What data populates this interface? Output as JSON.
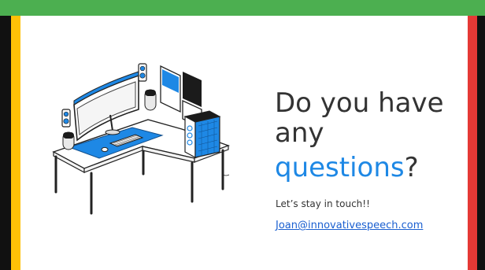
{
  "slide": {
    "heading_line1": "Do you have",
    "heading_line2": "any",
    "heading_line3_accent": "questions",
    "heading_line3_suffix": "?",
    "tagline": "Let’s stay in touch!!",
    "email": "Joan@innovativespeech.com"
  },
  "illustration": {
    "subject": "desk-setup-illustration",
    "accent_color": "#1e88e5",
    "items": [
      "curved-monitor-icon",
      "speaker-icon",
      "keyboard-icon",
      "mouse-icon",
      "pc-tower-icon",
      "picture-frame-icon",
      "desk-icon"
    ]
  },
  "frame": {
    "top_color": "#4caf50",
    "left_color": "#ffc107",
    "right_color": "#e53935"
  }
}
